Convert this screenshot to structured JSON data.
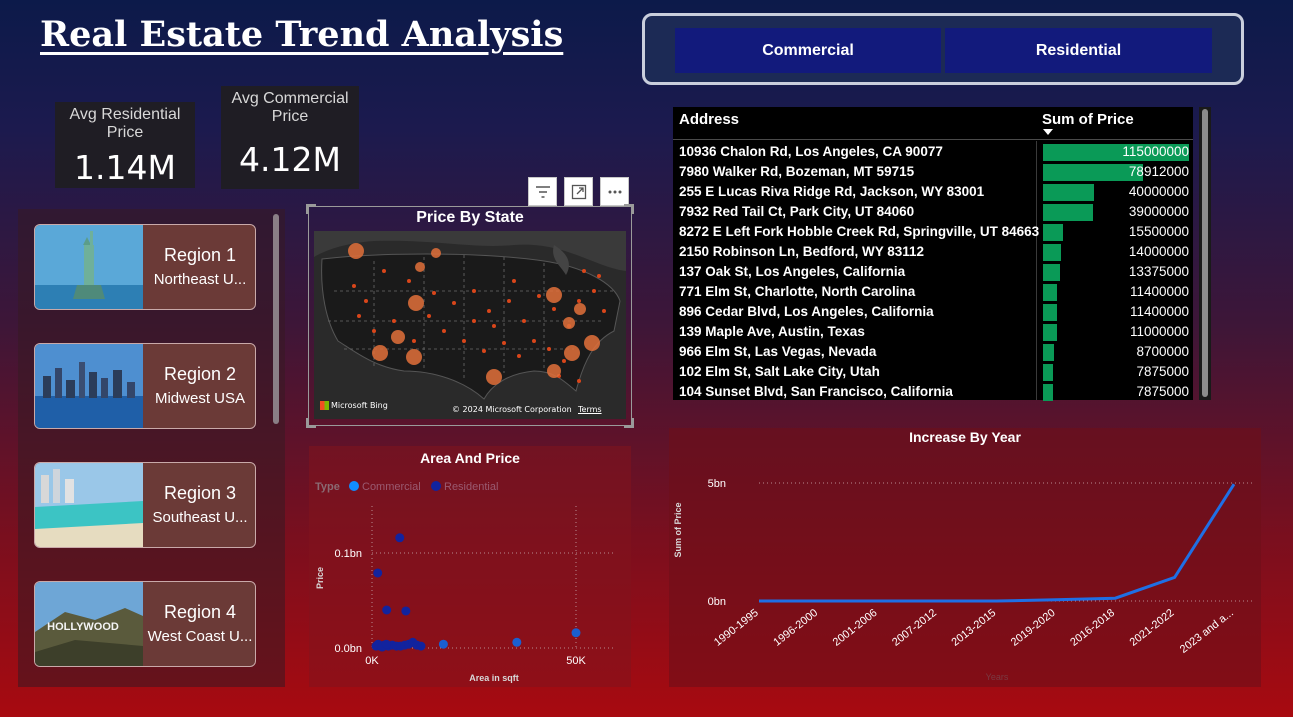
{
  "header": {
    "title": "Real Estate Trend Analysis "
  },
  "kpis": {
    "residential": {
      "label": "Avg Residential Price",
      "value": "1.14M"
    },
    "commercial": {
      "label": "Avg Commercial Price",
      "value": "4.12M"
    }
  },
  "slicer": {
    "buttons": [
      "Commercial",
      "Residential"
    ]
  },
  "regions": [
    {
      "title": "Region 1",
      "subtitle": "Northeast U..."
    },
    {
      "title": "Region 2",
      "subtitle": "Midwest USA"
    },
    {
      "title": "Region 3",
      "subtitle": "Southeast U..."
    },
    {
      "title": "Region 4",
      "subtitle": "West Coast U..."
    }
  ],
  "map": {
    "title": "Price By State",
    "bing_label": "Microsoft Bing",
    "copyright": "© 2024 Microsoft Corporation",
    "terms": "Terms",
    "visual_icons": [
      "filter-icon",
      "focus-mode-icon",
      "more-options-icon"
    ]
  },
  "table": {
    "headers": {
      "address": "Address",
      "price": "Sum of Price"
    },
    "rows": [
      {
        "address": "10936 Chalon Rd, Los Angeles, CA 90077",
        "price": 115000000,
        "display": "115000000"
      },
      {
        "address": "7980 Walker Rd, Bozeman, MT 59715",
        "price": 78912000,
        "display": "78912000"
      },
      {
        "address": "255 E Lucas Riva Ridge Rd, Jackson, WY 83001",
        "price": 40000000,
        "display": "40000000"
      },
      {
        "address": "7932 Red Tail Ct, Park City, UT 84060",
        "price": 39000000,
        "display": "39000000"
      },
      {
        "address": "8272 E Left Fork Hobble Creek Rd, Springville, UT 84663",
        "price": 15500000,
        "display": "15500000"
      },
      {
        "address": "2150 Robinson Ln, Bedford, WY 83112",
        "price": 14000000,
        "display": "14000000"
      },
      {
        "address": "137 Oak St, Los Angeles, California",
        "price": 13375000,
        "display": "13375000"
      },
      {
        "address": "771 Elm St, Charlotte, North Carolina",
        "price": 11400000,
        "display": "11400000"
      },
      {
        "address": "896 Cedar Blvd, Los Angeles, California",
        "price": 11400000,
        "display": "11400000"
      },
      {
        "address": "139 Maple Ave, Austin, Texas",
        "price": 11000000,
        "display": "11000000"
      },
      {
        "address": "966 Elm St, Las Vegas, Nevada",
        "price": 8700000,
        "display": "8700000"
      },
      {
        "address": "102 Elm St, Salt Lake City, Utah",
        "price": 7875000,
        "display": "7875000"
      },
      {
        "address": "104 Sunset Blvd, San Francisco, California",
        "price": 7875000,
        "display": "7875000"
      }
    ],
    "colors": {
      "bar": "#0a9a57"
    }
  },
  "scatter": {
    "title": "Area And Price",
    "legend_title": "Type",
    "legend": [
      {
        "name": "Commercial",
        "color": "#118dff"
      },
      {
        "name": "Residential",
        "color": "#12239e"
      }
    ],
    "xlabel": "Area in sqft",
    "ylabel": "Price",
    "xticks": [
      "0K",
      "50K"
    ],
    "yticks": [
      "0.0bn",
      "0.1bn"
    ]
  },
  "line": {
    "title": "Increase By Year",
    "ylabel": "Sum of Price",
    "xlabel": "Years",
    "yticks": [
      "0bn",
      "5bn"
    ],
    "color": "#1f6fe5"
  },
  "chart_data": [
    {
      "type": "line",
      "title": "Increase By Year",
      "categories": [
        "1990-1995",
        "1996-2000",
        "2001-2006",
        "2007-2012",
        "2013-2015",
        "2019-2020",
        "2016-2018",
        "2021-2022",
        "2023 and a..."
      ],
      "series": [
        {
          "values": [
            0.0,
            0.0,
            0.0,
            0.0,
            0.0,
            0.05,
            0.12,
            1.0,
            4.95
          ]
        }
      ],
      "ylabel": "Sum of Price",
      "xlabel": "Years",
      "ylim": [
        0,
        5
      ],
      "y_unit": "bn"
    },
    {
      "type": "scatter",
      "title": "Area And Price",
      "xlabel": "Area in sqft",
      "ylabel": "Price",
      "xlim": [
        0,
        50000
      ],
      "ylim": [
        0,
        0.1
      ],
      "y_unit": "bn",
      "series": [
        {
          "name": "Residential",
          "points": [
            [
              1000,
              0.002
            ],
            [
              2000,
              0.002
            ],
            [
              3000,
              0.003
            ],
            [
              4000,
              0.002
            ],
            [
              5000,
              0.003
            ],
            [
              6000,
              0.002
            ],
            [
              7000,
              0.002
            ],
            [
              1500,
              0.004
            ],
            [
              2500,
              0.001
            ],
            [
              3500,
              0.004
            ],
            [
              8000,
              0.003
            ],
            [
              9000,
              0.004
            ],
            [
              10000,
              0.006
            ],
            [
              11000,
              0.003
            ],
            [
              12000,
              0.002
            ],
            [
              1400,
              0.079
            ],
            [
              3600,
              0.04
            ],
            [
              6800,
              0.116
            ],
            [
              8300,
              0.039
            ]
          ]
        },
        {
          "name": "Commercial",
          "points": [
            [
              17500,
              0.004
            ],
            [
              35500,
              0.006
            ],
            [
              50000,
              0.016
            ]
          ]
        }
      ]
    }
  ]
}
